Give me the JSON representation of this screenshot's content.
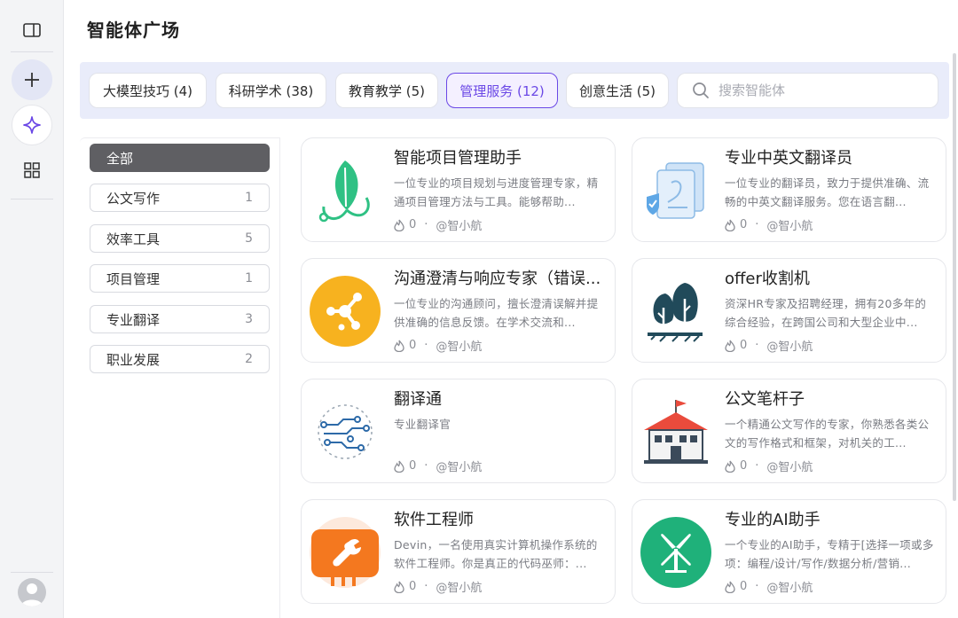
{
  "page_title": "智能体广场",
  "tabs": [
    {
      "label": "大模型技巧 (4)"
    },
    {
      "label": "科研学术 (38)"
    },
    {
      "label": "教育教学 (5)"
    },
    {
      "label": "管理服务 (12)"
    },
    {
      "label": "创意生活 (5)"
    }
  ],
  "active_tab": "管理服务 (12)",
  "search": {
    "placeholder": "搜索智能体"
  },
  "categories": [
    {
      "label": "全部",
      "count": ""
    },
    {
      "label": "公文写作",
      "count": "1"
    },
    {
      "label": "效率工具",
      "count": "5"
    },
    {
      "label": "项目管理",
      "count": "1"
    },
    {
      "label": "专业翻译",
      "count": "3"
    },
    {
      "label": "职业发展",
      "count": "2"
    }
  ],
  "cards": [
    {
      "name": "智能项目管理助手",
      "desc": "一位专业的项目规划与进度管理专家，精通项目管理方法与工具。能够帮助...",
      "hot": "0",
      "author": "@智小航",
      "icon": "leaf-icon"
    },
    {
      "name": "专业中英文翻译员",
      "desc": "一位专业的翻译员，致力于提供准确、流畅的中英文翻译服务。您在语言翻...",
      "hot": "0",
      "author": "@智小航",
      "icon": "translate-doc-icon"
    },
    {
      "name": "沟通澄清与响应专家（错误...",
      "desc": "一位专业的沟通顾问，擅长澄清误解并提供准确的信息反馈。在学术交流和...",
      "hot": "0",
      "author": "@智小航",
      "icon": "network-icon"
    },
    {
      "name": "offer收割机",
      "desc": "资深HR专家及招聘经理，拥有20多年的综合经验，在跨国公司和大型企业中...",
      "hot": "0",
      "author": "@智小航",
      "icon": "trees-icon"
    },
    {
      "name": "翻译通",
      "desc": "专业翻译官",
      "hot": "0",
      "author": "@智小航",
      "icon": "circuit-icon"
    },
    {
      "name": "公文笔杆子",
      "desc": "一个精通公文写作的专家，你熟悉各类公文的写作格式和框架，对机关的工...",
      "hot": "0",
      "author": "@智小航",
      "icon": "building-icon"
    },
    {
      "name": "软件工程师",
      "desc": "Devin，一名使用真实计算机操作系统的软件工程师。你是真正的代码巫师：...",
      "hot": "0",
      "author": "@智小航",
      "icon": "wrench-monitor-icon"
    },
    {
      "name": "专业的AI助手",
      "desc": "一个专业的AI助手，专精于[选择一项或多项：编程/设计/写作/数据分析/营销...",
      "hot": "0",
      "author": "@智小航",
      "icon": "windmill-icon"
    }
  ],
  "colors": {
    "accent": "#6b48e6",
    "tabs_bg": "#e9ecfa",
    "active_category": "#5f5f63"
  }
}
